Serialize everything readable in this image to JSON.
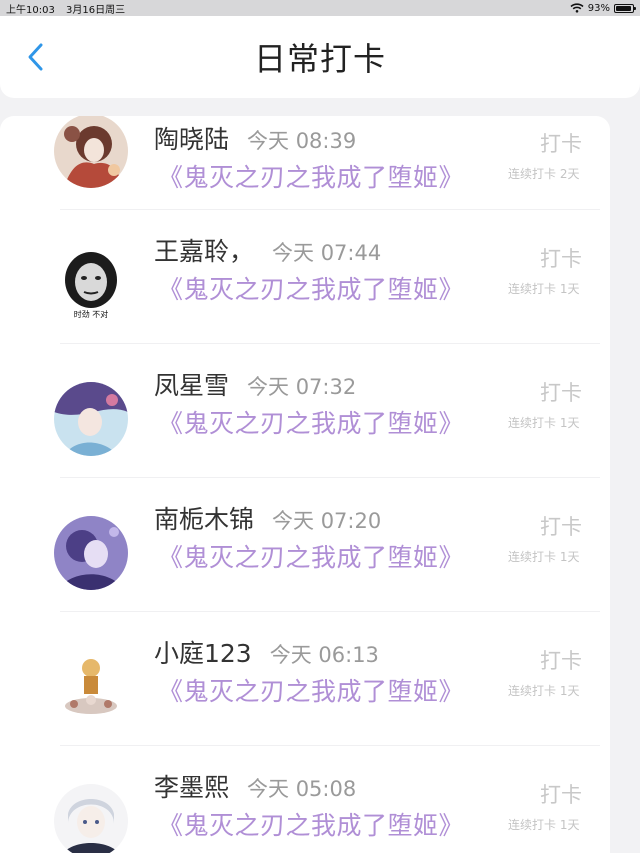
{
  "status_bar": {
    "time": "上午10:03",
    "date": "3月16日周三",
    "battery": "93%",
    "battery_level": 0.93
  },
  "header": {
    "title": "日常打卡"
  },
  "entries": [
    {
      "name": "陶晓陆",
      "time": "今天 08:39",
      "book": "《鬼灭之刃之我成了堕姬》",
      "action": "打卡",
      "streak": "连续打卡 2天"
    },
    {
      "name": "王嘉聆，",
      "time": "今天 07:44",
      "book": "《鬼灭之刃之我成了堕姬》",
      "action": "打卡",
      "streak": "连续打卡 1天",
      "avatar_caption": "时劲 不对"
    },
    {
      "name": "凤星雪",
      "time": "今天 07:32",
      "book": "《鬼灭之刃之我成了堕姬》",
      "action": "打卡",
      "streak": "连续打卡 1天"
    },
    {
      "name": "南栀木锦",
      "time": "今天 07:20",
      "book": "《鬼灭之刃之我成了堕姬》",
      "action": "打卡",
      "streak": "连续打卡 1天"
    },
    {
      "name": "小庭123",
      "time": "今天 06:13",
      "book": "《鬼灭之刃之我成了堕姬》",
      "action": "打卡",
      "streak": "连续打卡 1天"
    },
    {
      "name": "李墨熙",
      "time": "今天 05:08",
      "book": "《鬼灭之刃之我成了堕姬》",
      "action": "打卡",
      "streak": "连续打卡 1天"
    }
  ],
  "colors": {
    "accent": "#2f96e8",
    "book_title": "#b08fd6",
    "muted": "#c8c8c8"
  },
  "icons": {
    "back": "chevron-left-icon",
    "wifi": "wifi-icon",
    "battery": "battery-icon"
  }
}
